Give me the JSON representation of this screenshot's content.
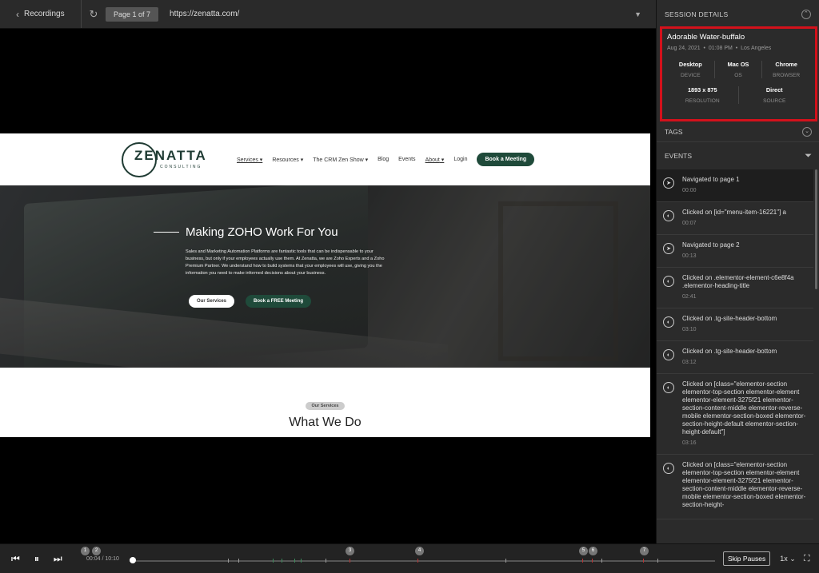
{
  "topbar": {
    "back_label": "Recordings",
    "page_indicator": "Page 1 of 7",
    "url": "https://zenatta.com/"
  },
  "site": {
    "logo_word": "ZENATTA",
    "logo_sub": "CONSULTING",
    "nav": [
      "Services",
      "Resources",
      "The CRM Zen Show",
      "Blog",
      "Events",
      "About",
      "Login"
    ],
    "nav_cta": "Book a Meeting",
    "hero_title": "Making ZOHO Work For You",
    "hero_text": "Sales and Marketing Automation Platforms are fantastic tools that can be indispensable to your business, but only if your employees actually use them. At Zenatta, we are Zoho Experts and a Zoho Premium Partner. We understand how to build systems that your employees will use, giving you the information you need to make informed decisions about your business.",
    "btn_services": "Our Services",
    "btn_meeting": "Book a FREE Meeting",
    "section_pill": "Our Services",
    "section_title": "What We Do"
  },
  "player": {
    "current_time": "00:04",
    "total_time": "10:10",
    "skip_label": "Skip Pauses",
    "speed": "1x",
    "markers": [
      "1",
      "2",
      "3",
      "4",
      "5",
      "6",
      "7"
    ]
  },
  "panel": {
    "session_title": "SESSION DETAILS",
    "session_name": "Adorable Water-buffalo",
    "session_date": "Aug 24, 2021",
    "session_time": "01:08 PM",
    "session_location": "Los Angeles",
    "device_value": "Desktop",
    "device_key": "DEVICE",
    "os_value": "Mac OS",
    "os_key": "OS",
    "browser_value": "Chrome",
    "browser_key": "BROWSER",
    "resolution_value": "1893 x 875",
    "resolution_key": "RESOLUTION",
    "source_value": "Direct",
    "source_key": "SOURCE",
    "tags_title": "TAGS",
    "events_title": "EVENTS",
    "events": [
      {
        "text": "Navigated to page 1",
        "time": "00:00",
        "icon": "navigate-icon"
      },
      {
        "text": "Clicked on [id=\"menu-item-16221\"] a",
        "time": "00:07",
        "icon": "mouse-click-icon"
      },
      {
        "text": "Navigated to page 2",
        "time": "00:13",
        "icon": "navigate-icon"
      },
      {
        "text": "Clicked on .elementor-element-c6e8f4a .elementor-heading-title",
        "time": "02:41",
        "icon": "mouse-click-icon"
      },
      {
        "text": "Clicked on .tg-site-header-bottom",
        "time": "03:10",
        "icon": "mouse-click-icon"
      },
      {
        "text": "Clicked on .tg-site-header-bottom",
        "time": "03:12",
        "icon": "mouse-click-icon"
      },
      {
        "text": "Clicked on [class=\"elementor-section elementor-top-section elementor-element elementor-element-3275f21 elementor-section-content-middle elementor-reverse-mobile elementor-section-boxed elementor-section-height-default elementor-section-height-default\"]",
        "time": "03:16",
        "icon": "mouse-click-icon"
      },
      {
        "text": "Clicked on [class=\"elementor-section elementor-top-section elementor-element elementor-element-3275f21 elementor-section-content-middle elementor-reverse-mobile elementor-section-boxed elementor-section-height-",
        "time": "",
        "icon": "mouse-click-icon"
      }
    ]
  },
  "colors": {
    "highlight_border": "#d3111b",
    "brand_green": "#1f4a3a"
  }
}
